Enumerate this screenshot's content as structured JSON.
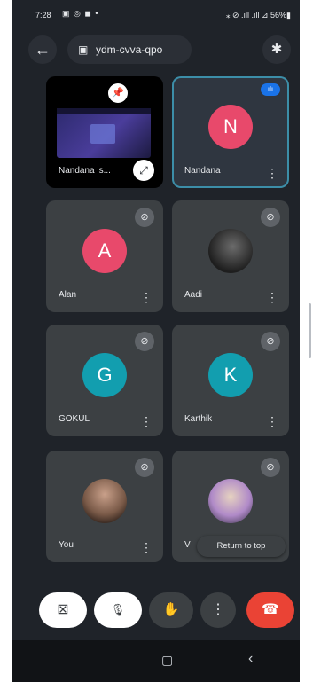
{
  "status_bar": {
    "time": "7:28",
    "notifications": "▣ ◎ ◼ •",
    "right": "⁎ ⊘ .ıll .ıll ⊿ 56%▮"
  },
  "top_bar": {
    "back_icon": "←",
    "meeting_icon": "▣",
    "meeting_code": "ydm-cvva-qpo",
    "bluetooth_icon": "✱"
  },
  "tiles": [
    {
      "name": "Nandana is...",
      "kind": "screen-share",
      "pin_icon": "⬤",
      "expand_icon": "⤢"
    },
    {
      "name": "Nandana",
      "kind": "avatar",
      "initial": "N",
      "avatar_color": "#e8496b",
      "speaking_icon": "ılı",
      "highlight_color": "#3c8ea8"
    },
    {
      "name": "Alan",
      "kind": "avatar",
      "initial": "A",
      "avatar_color": "#e8496b",
      "mute_icon": "⊘"
    },
    {
      "name": "Aadi",
      "kind": "photo",
      "mute_icon": "⊘"
    },
    {
      "name": "GOKUL",
      "kind": "avatar",
      "initial": "G",
      "avatar_color": "#129eaf",
      "mute_icon": "⊘"
    },
    {
      "name": "Karthik",
      "kind": "avatar",
      "initial": "K",
      "avatar_color": "#129eaf",
      "mute_icon": "⊘"
    },
    {
      "name": "You",
      "kind": "photo",
      "mute_icon": "⊘"
    },
    {
      "name": "V",
      "kind": "photo",
      "mute_icon": "⊘"
    }
  ],
  "tooltip": {
    "label": "Return to top"
  },
  "controls": {
    "camera_off_icon": "⊠",
    "mic_off_icon": "🎙",
    "raise_hand_icon": "✋",
    "more_icon": "⋮",
    "end_call_icon": "☎",
    "end_call_color": "#ea4335"
  },
  "nav_bar": {
    "home_icon": "▢",
    "back_icon": "‹"
  },
  "more_icon": "⋮"
}
